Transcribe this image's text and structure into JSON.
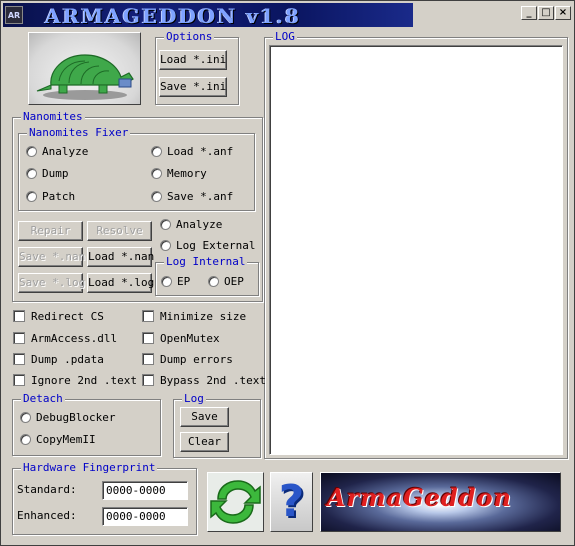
{
  "window": {
    "title": "ARMAGEDDON v1.8",
    "icon_text": "AR",
    "controls": {
      "minimize": "_",
      "maximize": "□",
      "close": "×"
    }
  },
  "options": {
    "label": "Options",
    "load_ini": "Load *.ini",
    "save_ini": "Save *.ini"
  },
  "log_panel": {
    "label": "LOG"
  },
  "nanomites": {
    "label": "Nanomites",
    "fixer_label": "Nanomites Fixer",
    "fixer_radios": [
      "Analyze",
      "Load *.anf",
      "Dump",
      "Memory",
      "Patch",
      "Save *.anf"
    ],
    "repair": "Repair",
    "resolve": "Resolve",
    "save_nan": "Save *.nan",
    "load_nan": "Load *.nan",
    "save_log": "Save *.log",
    "load_log": "Load *.log",
    "analyze": "Analyze",
    "log_external": "Log External",
    "log_internal_label": "Log Internal",
    "ep": "EP",
    "oep": "OEP"
  },
  "checks": {
    "redirect_cs": "Redirect CS",
    "minimize_size": "Minimize size",
    "armaccess": "ArmAccess.dll",
    "openmutex": "OpenMutex",
    "dump_pdata": "Dump .pdata",
    "dump_errors": "Dump errors",
    "ignore_text": "Ignore 2nd .text",
    "bypass_text": "Bypass 2nd .text"
  },
  "detach": {
    "label": "Detach",
    "debugblocker": "DebugBlocker",
    "copymem": "CopyMemII"
  },
  "log_group": {
    "label": "Log",
    "save": "Save",
    "clear": "Clear"
  },
  "fingerprint": {
    "label": "Hardware Fingerprint",
    "standard_label": "Standard:",
    "standard_value": "0000-0000",
    "enhanced_label": "Enhanced:",
    "enhanced_value": "0000-0000"
  },
  "bottom": {
    "help_glyph": "?",
    "banner_text": "ArmaGeddon"
  }
}
